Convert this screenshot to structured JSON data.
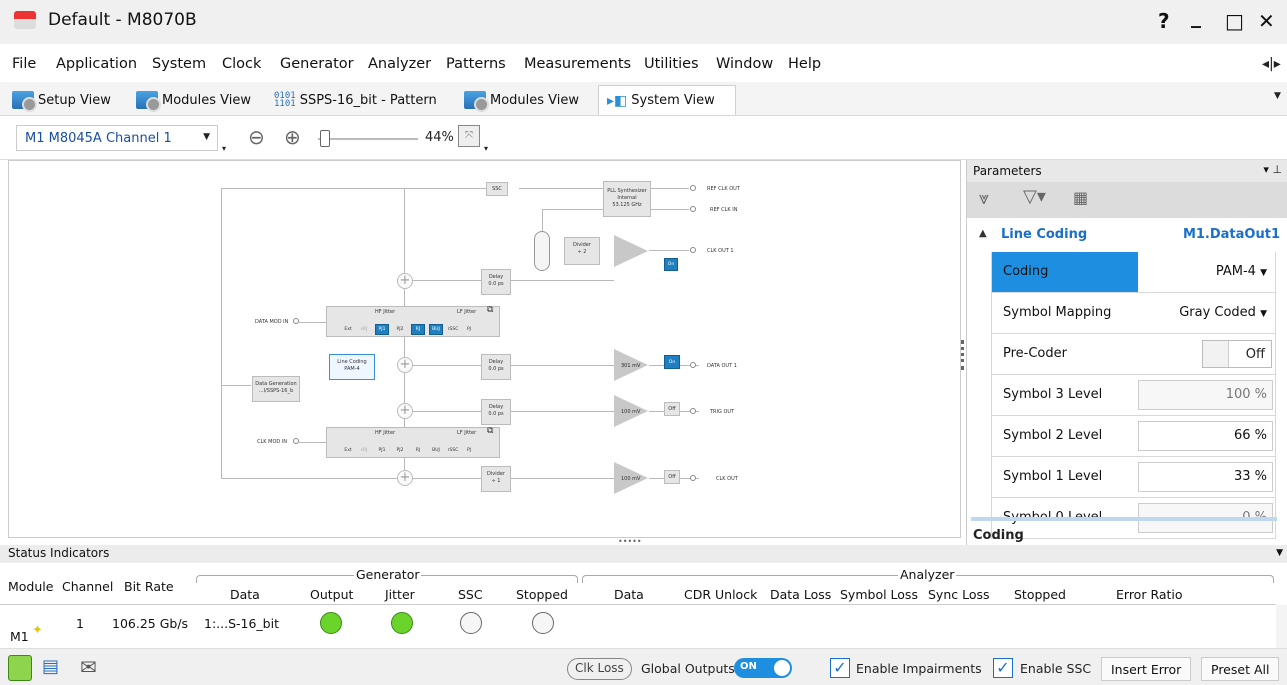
{
  "window": {
    "title": "Default - M8070B",
    "help": "?",
    "minimize": "_",
    "restore": "□",
    "close": "✕"
  },
  "menu": [
    "File",
    "Application",
    "System",
    "Clock",
    "Generator",
    "Analyzer",
    "Patterns",
    "Measurements",
    "Utilities",
    "Window",
    "Help"
  ],
  "tabs": [
    {
      "label": "Setup View",
      "icon": "data-gear-icon"
    },
    {
      "label": "Modules View",
      "icon": "data-gear-icon"
    },
    {
      "label": "SSPS-16_bit - Pattern",
      "icon": "pattern-icon"
    },
    {
      "label": "Modules View",
      "icon": "data-gear-icon"
    },
    {
      "label": "System View",
      "icon": "system-view-icon",
      "active": true
    }
  ],
  "toolbar": {
    "channel": "M1 M8045A Channel 1",
    "zoom": "44%"
  },
  "diagram": {
    "ssc": "SSC",
    "pll": [
      "PLL Synthesizer",
      "Internal",
      "53.125 GHz"
    ],
    "ref_clk_out": "REF CLK OUT",
    "ref_clk_in": "REF CLK IN",
    "divider": "Divider",
    "div2": "÷ 2",
    "div1": "÷ 1",
    "clk_out1": "CLK OUT 1",
    "delay": "Delay",
    "delay_val": "0.0 ps",
    "hf_jitter": "HF Jitter",
    "lf_jitter": "LF Jitter",
    "data_mod_in": "DATA MOD IN",
    "clk_mod_in": "CLK MOD IN",
    "jit_btns": [
      "Ext",
      "sRJ",
      "PJ1",
      "PJ2",
      "RJ",
      "BUJ",
      "rSSC",
      "PJ"
    ],
    "line_coding": "Line Coding",
    "pam4": "PAM-4",
    "data_gen": "Data Generation",
    "data_gen_val": "...I/SSPS-16_b",
    "amp1": "301 mV",
    "amp2": "100 mV",
    "amp3": "100 mV",
    "on": "On",
    "off": "Off",
    "data_out1": "DATA OUT 1",
    "trig_out": "TRIG OUT",
    "clk_out": "CLK OUT"
  },
  "parameters": {
    "title": "Parameters",
    "section": "Line Coding",
    "target": "M1.DataOut1",
    "rows": [
      {
        "name": "Coding",
        "value": "PAM-4",
        "type": "dropdown",
        "selected": true
      },
      {
        "name": "Symbol Mapping",
        "value": "Gray Coded",
        "type": "dropdown"
      },
      {
        "name": "Pre-Coder",
        "value": "Off",
        "type": "toggle"
      },
      {
        "name": "Symbol 3 Level",
        "value": "100 %",
        "type": "input"
      },
      {
        "name": "Symbol 2 Level",
        "value": "66 %",
        "type": "input"
      },
      {
        "name": "Symbol 1 Level",
        "value": "33 %",
        "type": "input"
      },
      {
        "name": "Symbol 0 Level",
        "value": "0 %",
        "type": "input"
      }
    ],
    "footer": "Coding"
  },
  "status": {
    "title": "Status Indicators",
    "generator": "Generator",
    "analyzer": "Analyzer",
    "cols": [
      "Module",
      "Channel",
      "Bit Rate",
      "Data",
      "Output",
      "Jitter",
      "SSC",
      "Stopped",
      "Data",
      "CDR Unlock",
      "Data Loss",
      "Symbol Loss",
      "Sync Loss",
      "Stopped",
      "Error Ratio"
    ],
    "row": {
      "module": "M1",
      "channel": "1",
      "bitrate": "106.25 Gb/s",
      "data": "1:...S-16_bit"
    }
  },
  "bottom": {
    "clk_loss": "Clk Loss",
    "global_outputs": "Global Outputs",
    "on": "ON",
    "enable_impairments": "Enable Impairments",
    "enable_ssc": "Enable SSC",
    "insert_error": "Insert Error",
    "preset_all": "Preset All"
  }
}
